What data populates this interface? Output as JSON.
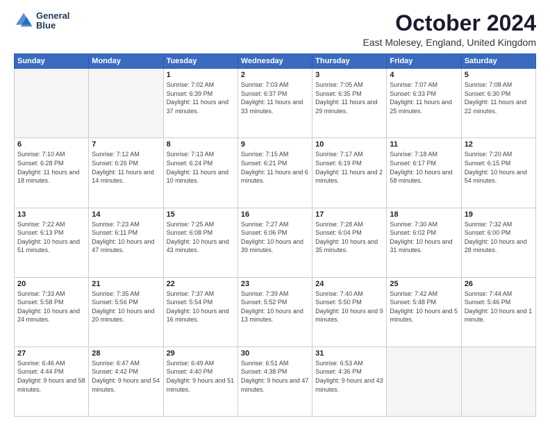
{
  "header": {
    "logo_line1": "General",
    "logo_line2": "Blue",
    "month": "October 2024",
    "location": "East Molesey, England, United Kingdom"
  },
  "weekdays": [
    "Sunday",
    "Monday",
    "Tuesday",
    "Wednesday",
    "Thursday",
    "Friday",
    "Saturday"
  ],
  "weeks": [
    [
      {
        "day": "",
        "info": ""
      },
      {
        "day": "",
        "info": ""
      },
      {
        "day": "1",
        "info": "Sunrise: 7:02 AM\nSunset: 6:39 PM\nDaylight: 11 hours and 37 minutes."
      },
      {
        "day": "2",
        "info": "Sunrise: 7:03 AM\nSunset: 6:37 PM\nDaylight: 11 hours and 33 minutes."
      },
      {
        "day": "3",
        "info": "Sunrise: 7:05 AM\nSunset: 6:35 PM\nDaylight: 11 hours and 29 minutes."
      },
      {
        "day": "4",
        "info": "Sunrise: 7:07 AM\nSunset: 6:33 PM\nDaylight: 11 hours and 25 minutes."
      },
      {
        "day": "5",
        "info": "Sunrise: 7:08 AM\nSunset: 6:30 PM\nDaylight: 11 hours and 22 minutes."
      }
    ],
    [
      {
        "day": "6",
        "info": "Sunrise: 7:10 AM\nSunset: 6:28 PM\nDaylight: 11 hours and 18 minutes."
      },
      {
        "day": "7",
        "info": "Sunrise: 7:12 AM\nSunset: 6:26 PM\nDaylight: 11 hours and 14 minutes."
      },
      {
        "day": "8",
        "info": "Sunrise: 7:13 AM\nSunset: 6:24 PM\nDaylight: 11 hours and 10 minutes."
      },
      {
        "day": "9",
        "info": "Sunrise: 7:15 AM\nSunset: 6:21 PM\nDaylight: 11 hours and 6 minutes."
      },
      {
        "day": "10",
        "info": "Sunrise: 7:17 AM\nSunset: 6:19 PM\nDaylight: 11 hours and 2 minutes."
      },
      {
        "day": "11",
        "info": "Sunrise: 7:18 AM\nSunset: 6:17 PM\nDaylight: 10 hours and 58 minutes."
      },
      {
        "day": "12",
        "info": "Sunrise: 7:20 AM\nSunset: 6:15 PM\nDaylight: 10 hours and 54 minutes."
      }
    ],
    [
      {
        "day": "13",
        "info": "Sunrise: 7:22 AM\nSunset: 6:13 PM\nDaylight: 10 hours and 51 minutes."
      },
      {
        "day": "14",
        "info": "Sunrise: 7:23 AM\nSunset: 6:11 PM\nDaylight: 10 hours and 47 minutes."
      },
      {
        "day": "15",
        "info": "Sunrise: 7:25 AM\nSunset: 6:08 PM\nDaylight: 10 hours and 43 minutes."
      },
      {
        "day": "16",
        "info": "Sunrise: 7:27 AM\nSunset: 6:06 PM\nDaylight: 10 hours and 39 minutes."
      },
      {
        "day": "17",
        "info": "Sunrise: 7:28 AM\nSunset: 6:04 PM\nDaylight: 10 hours and 35 minutes."
      },
      {
        "day": "18",
        "info": "Sunrise: 7:30 AM\nSunset: 6:02 PM\nDaylight: 10 hours and 31 minutes."
      },
      {
        "day": "19",
        "info": "Sunrise: 7:32 AM\nSunset: 6:00 PM\nDaylight: 10 hours and 28 minutes."
      }
    ],
    [
      {
        "day": "20",
        "info": "Sunrise: 7:33 AM\nSunset: 5:58 PM\nDaylight: 10 hours and 24 minutes."
      },
      {
        "day": "21",
        "info": "Sunrise: 7:35 AM\nSunset: 5:56 PM\nDaylight: 10 hours and 20 minutes."
      },
      {
        "day": "22",
        "info": "Sunrise: 7:37 AM\nSunset: 5:54 PM\nDaylight: 10 hours and 16 minutes."
      },
      {
        "day": "23",
        "info": "Sunrise: 7:39 AM\nSunset: 5:52 PM\nDaylight: 10 hours and 13 minutes."
      },
      {
        "day": "24",
        "info": "Sunrise: 7:40 AM\nSunset: 5:50 PM\nDaylight: 10 hours and 9 minutes."
      },
      {
        "day": "25",
        "info": "Sunrise: 7:42 AM\nSunset: 5:48 PM\nDaylight: 10 hours and 5 minutes."
      },
      {
        "day": "26",
        "info": "Sunrise: 7:44 AM\nSunset: 5:46 PM\nDaylight: 10 hours and 1 minute."
      }
    ],
    [
      {
        "day": "27",
        "info": "Sunrise: 6:46 AM\nSunset: 4:44 PM\nDaylight: 9 hours and 58 minutes."
      },
      {
        "day": "28",
        "info": "Sunrise: 6:47 AM\nSunset: 4:42 PM\nDaylight: 9 hours and 54 minutes."
      },
      {
        "day": "29",
        "info": "Sunrise: 6:49 AM\nSunset: 4:40 PM\nDaylight: 9 hours and 51 minutes."
      },
      {
        "day": "30",
        "info": "Sunrise: 6:51 AM\nSunset: 4:38 PM\nDaylight: 9 hours and 47 minutes."
      },
      {
        "day": "31",
        "info": "Sunrise: 6:53 AM\nSunset: 4:36 PM\nDaylight: 9 hours and 43 minutes."
      },
      {
        "day": "",
        "info": ""
      },
      {
        "day": "",
        "info": ""
      }
    ]
  ]
}
